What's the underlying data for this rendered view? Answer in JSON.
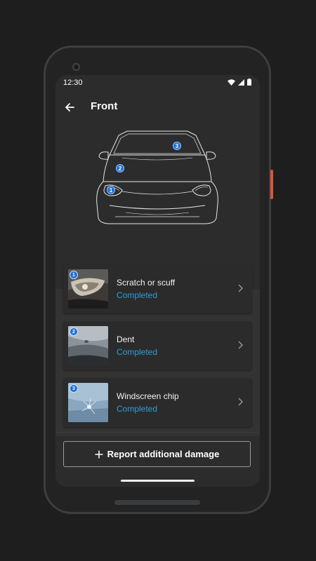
{
  "status_bar": {
    "time": "12:30"
  },
  "header": {
    "title": "Front"
  },
  "diagram": {
    "markers": [
      "3",
      "2",
      "1"
    ]
  },
  "damages": [
    {
      "number": "1",
      "title": "Scratch or scuff",
      "status": "Completed"
    },
    {
      "number": "2",
      "title": "Dent",
      "status": "Completed"
    },
    {
      "number": "3",
      "title": "Windscreen chip",
      "status": "Completed"
    }
  ],
  "actions": {
    "report_label": "Report additional damage"
  },
  "colors": {
    "accent": "#2a9fd6",
    "marker": "#1f6fd6",
    "device_button": "#d9573a"
  }
}
